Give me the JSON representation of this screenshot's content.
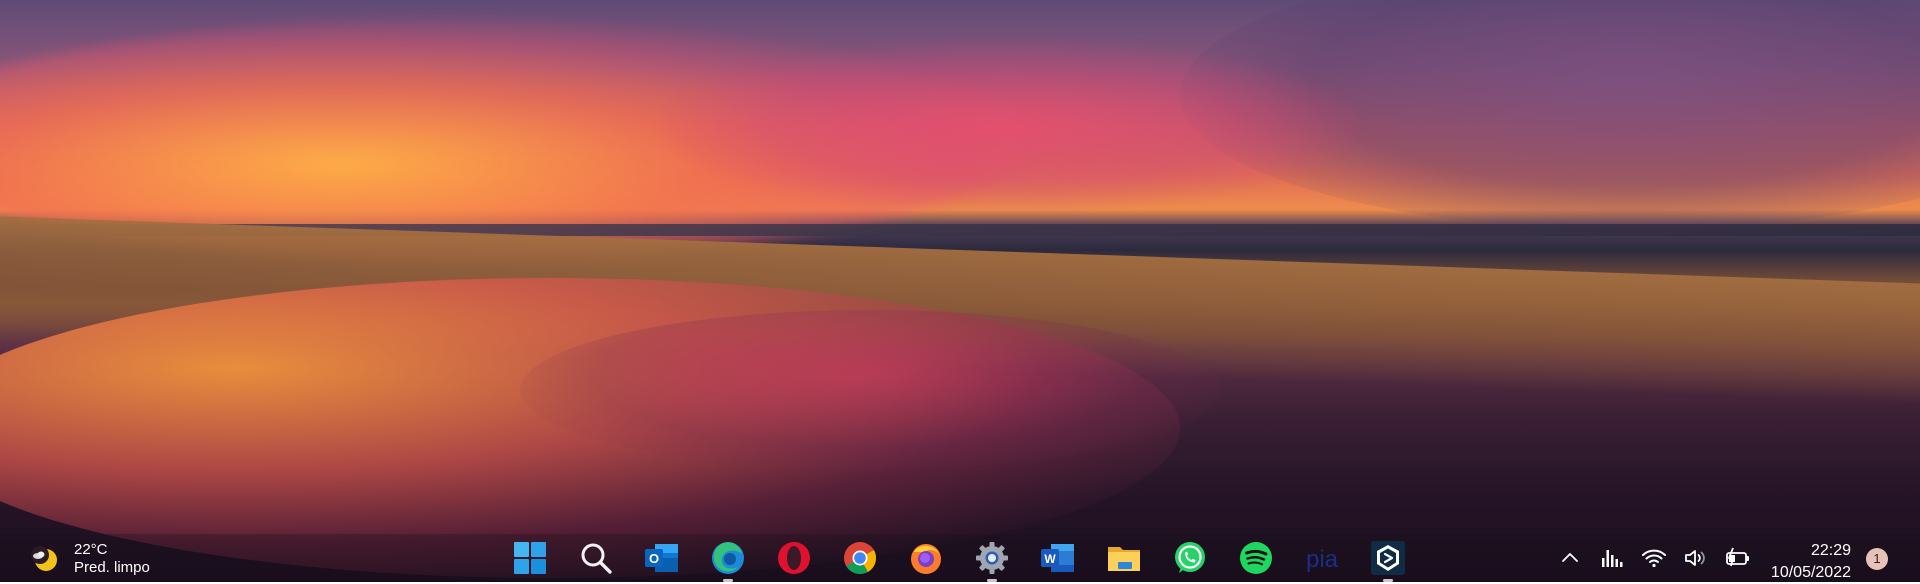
{
  "weather": {
    "temperature": "22°C",
    "description": "Pred. limpo",
    "icon": "moon-clear-icon"
  },
  "taskbar": {
    "apps": [
      {
        "name": "windows-start",
        "icon": "windows-logo-icon",
        "running": false
      },
      {
        "name": "search",
        "icon": "search-icon",
        "running": false
      },
      {
        "name": "outlook",
        "icon": "outlook-icon",
        "running": false
      },
      {
        "name": "edge",
        "icon": "edge-icon",
        "running": true
      },
      {
        "name": "opera",
        "icon": "opera-icon",
        "running": false
      },
      {
        "name": "chrome",
        "icon": "chrome-icon",
        "running": false
      },
      {
        "name": "firefox",
        "icon": "firefox-icon",
        "running": false
      },
      {
        "name": "settings",
        "icon": "gear-icon",
        "running": true
      },
      {
        "name": "word",
        "icon": "word-icon",
        "running": false
      },
      {
        "name": "file-explorer",
        "icon": "folder-icon",
        "running": false
      },
      {
        "name": "whatsapp",
        "icon": "whatsapp-icon",
        "running": false
      },
      {
        "name": "spotify",
        "icon": "spotify-icon",
        "running": false
      },
      {
        "name": "pia",
        "icon": "pia-icon",
        "label": "pia",
        "running": false
      },
      {
        "name": "deepl",
        "icon": "deepl-icon",
        "running": true
      }
    ]
  },
  "tray": {
    "icons": [
      "chevron-up-icon",
      "equalizer-icon",
      "wifi-icon",
      "volume-icon",
      "battery-charging-icon"
    ]
  },
  "clock": {
    "time": "22:29",
    "date": "10/05/2022"
  },
  "notifications": {
    "count": "1"
  },
  "colors": {
    "accent": "#00a4ef",
    "indicator": "#d7c3c7",
    "notification_badge": "#e6c3b6"
  }
}
